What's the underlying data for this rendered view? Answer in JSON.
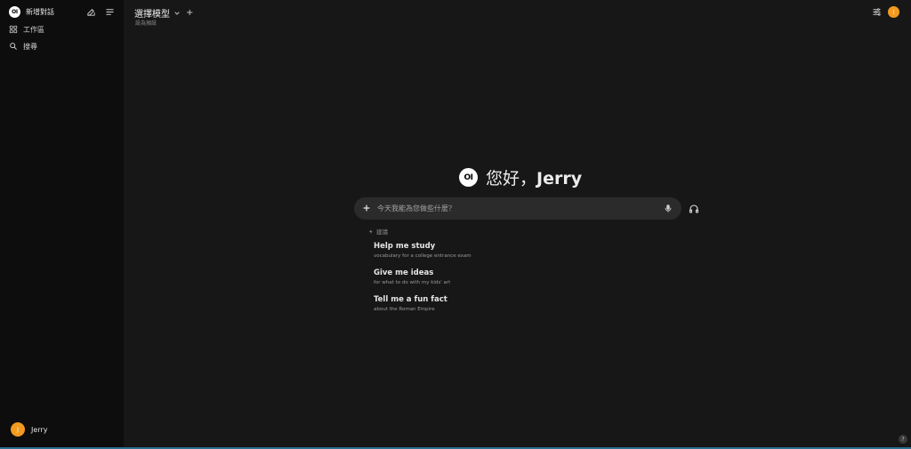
{
  "sidebar": {
    "logo_text": "OI",
    "new_chat_label": "新增對話",
    "items": [
      {
        "label": "工作區",
        "icon": "grid-icon"
      },
      {
        "label": "搜尋",
        "icon": "search-icon"
      }
    ],
    "user": {
      "initial": "J",
      "name": "Jerry",
      "avatar_color": "#f29a1f"
    }
  },
  "header": {
    "model_label": "選擇模型",
    "add_model": "+",
    "set_default": "設為預設",
    "user_initial": "J"
  },
  "greeting": {
    "logo_text": "OI",
    "text": "您好，",
    "name": "Jerry"
  },
  "input": {
    "placeholder": "今天我能為您做些什麼？"
  },
  "suggestions": {
    "heading": "建議",
    "items": [
      {
        "title": "Help me study",
        "subtitle": "vocabulary for a college entrance exam"
      },
      {
        "title": "Give me ideas",
        "subtitle": "for what to do with my kids' art"
      },
      {
        "title": "Tell me a fun fact",
        "subtitle": "about the Roman Empire"
      }
    ]
  },
  "help": {
    "label": "?"
  },
  "colors": {
    "accent": "#f29a1f",
    "background": "#171717",
    "sidebar": "#0d0d0d",
    "input": "#2b2b2b"
  }
}
